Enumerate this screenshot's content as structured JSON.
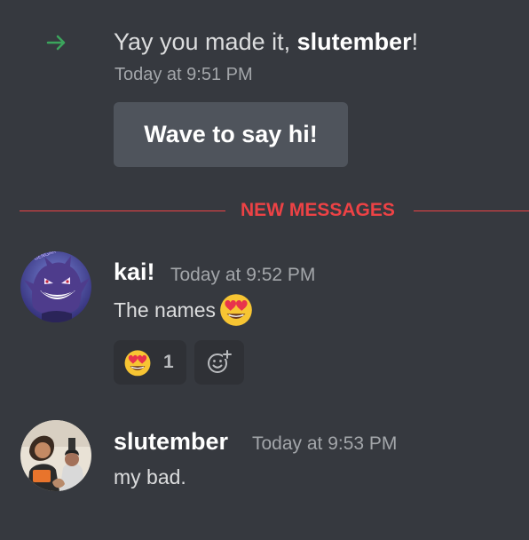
{
  "system_message": {
    "icon": "arrow-right-icon",
    "text_prefix": "Yay you made it, ",
    "username": "slutember",
    "text_suffix": "!",
    "timestamp": "Today at 9:51 PM",
    "wave_button_label": "Wave to say hi!"
  },
  "divider": {
    "label": "NEW MESSAGES",
    "color": "#ed4245"
  },
  "messages": [
    {
      "author": "kai!",
      "timestamp": "Today at 9:52 PM",
      "text": "The names",
      "inline_emoji": "heart-eyes-emoji",
      "reactions": [
        {
          "emoji": "heart-eyes-emoji",
          "count": "1"
        }
      ],
      "add_reaction_icon": "add-reaction-icon"
    },
    {
      "author": "slutember",
      "timestamp": "Today at 9:53 PM",
      "text": "my bad."
    }
  ],
  "colors": {
    "background": "#36393f",
    "button": "#4f545c",
    "reaction_bg": "#2f3136",
    "join_arrow": "#3ba55c"
  }
}
